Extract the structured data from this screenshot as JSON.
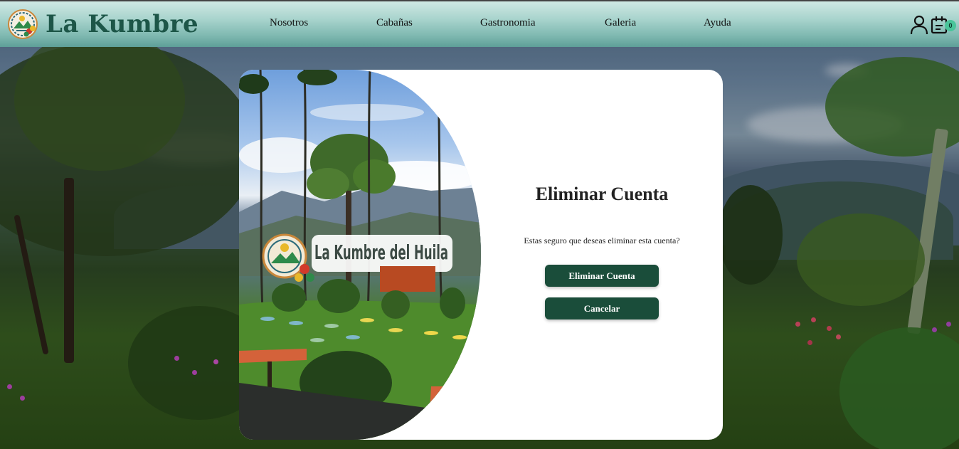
{
  "brand": {
    "name": "La Kumbre"
  },
  "nav": {
    "items": [
      {
        "label": "Nosotros"
      },
      {
        "label": "Cabañas"
      },
      {
        "label": "Gastronomia"
      },
      {
        "label": "Galeria"
      },
      {
        "label": "Ayuda"
      }
    ]
  },
  "header_icons": {
    "user_icon": "user-icon",
    "cart_icon": "cart-icon",
    "cart_count": "0"
  },
  "modal": {
    "title": "Eliminar Cuenta",
    "message": "Estas seguro que deseas eliminar esta cuenta?",
    "delete_label": "Eliminar Cuenta",
    "cancel_label": "Cancelar",
    "image_sign_text": "La Kumbre del Huila"
  },
  "colors": {
    "header_gradient_top": "#cfe8e4",
    "header_gradient_bottom": "#5e9f98",
    "brand_text": "#1d5648",
    "button_bg": "#1a4d3a",
    "button_text": "#ffffff",
    "badge": "#4ac59a"
  }
}
